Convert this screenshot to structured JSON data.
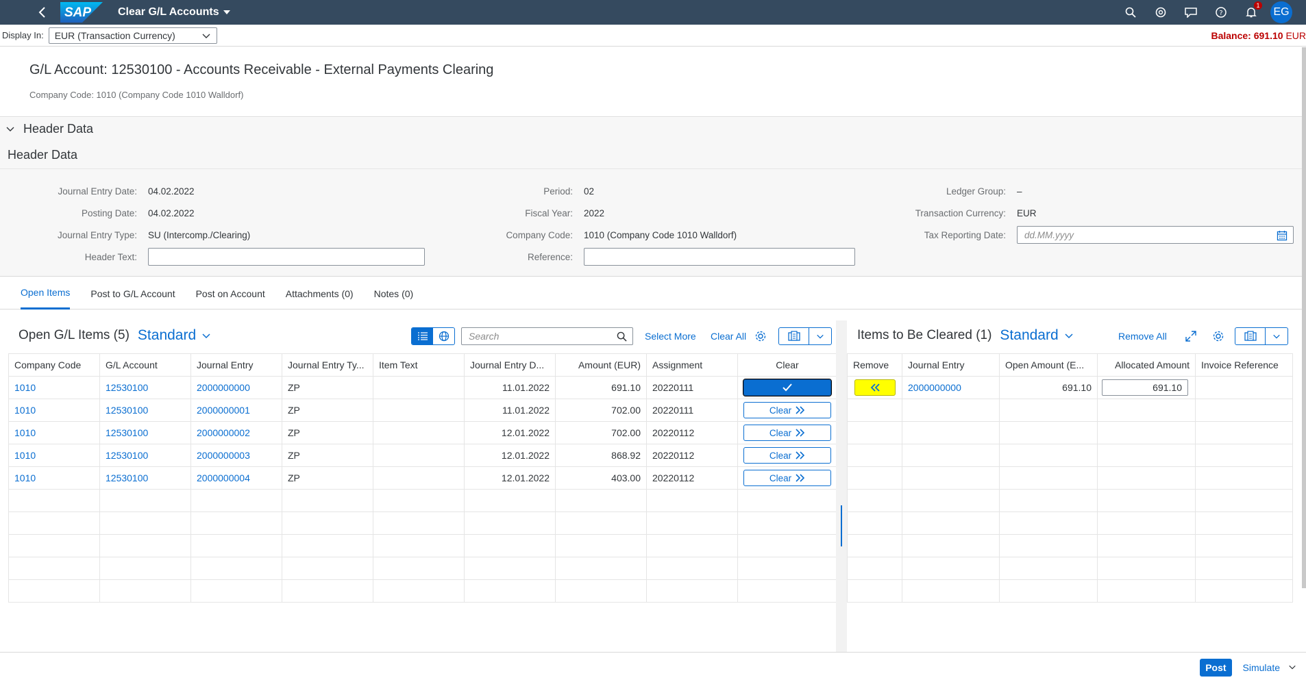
{
  "shell": {
    "title": "Clear G/L Accounts",
    "logo": "SAP",
    "notification_count": "1",
    "user_initials": "EG",
    "icons": [
      "back-icon",
      "search-icon",
      "copilot-icon",
      "feedback-icon",
      "help-icon",
      "bell-icon"
    ]
  },
  "display": {
    "label": "Display In:",
    "value": "EUR (Transaction Currency)",
    "balance_label": "Balance:",
    "balance_value": "691.10",
    "balance_currency": "EUR"
  },
  "header": {
    "title": "G/L Account: 12530100 - Accounts Receivable - External Payments Clearing",
    "subtitle": "Company Code: 1010 (Company Code 1010 Walldorf)"
  },
  "header_data": {
    "toggle_label": "Header Data",
    "section_title": "Header Data",
    "fields": {
      "journal_entry_date": {
        "label": "Journal Entry Date:",
        "value": "04.02.2022"
      },
      "posting_date": {
        "label": "Posting Date:",
        "value": "04.02.2022"
      },
      "journal_entry_type": {
        "label": "Journal Entry Type:",
        "value": "SU (Intercomp./Clearing)"
      },
      "header_text": {
        "label": "Header Text:",
        "value": ""
      },
      "period": {
        "label": "Period:",
        "value": "02"
      },
      "fiscal_year": {
        "label": "Fiscal Year:",
        "value": "2022"
      },
      "company_code": {
        "label": "Company Code:",
        "value": "1010 (Company Code 1010 Walldorf)"
      },
      "reference": {
        "label": "Reference:",
        "value": ""
      },
      "ledger_group": {
        "label": "Ledger Group:",
        "value": "–"
      },
      "transaction_currency": {
        "label": "Transaction Currency:",
        "value": "EUR"
      },
      "tax_reporting_date": {
        "label": "Tax Reporting Date:",
        "placeholder": "dd.MM.yyyy"
      }
    }
  },
  "tabs": [
    {
      "label": "Open Items",
      "active": true
    },
    {
      "label": "Post to G/L Account"
    },
    {
      "label": "Post on Account"
    },
    {
      "label": "Attachments (0)"
    },
    {
      "label": "Notes (0)"
    }
  ],
  "open_items": {
    "title": "Open G/L Items (5)",
    "variant": "Standard",
    "search_placeholder": "Search",
    "select_more": "Select More",
    "clear_all": "Clear All",
    "columns": [
      "Company Code",
      "G/L Account",
      "Journal Entry",
      "Journal Entry Ty...",
      "Item Text",
      "Journal Entry D...",
      "Amount (EUR)",
      "Assignment",
      "Clear"
    ],
    "clear_label": "Clear",
    "rows": [
      {
        "company_code": "1010",
        "gl_account": "12530100",
        "journal_entry": "2000000000",
        "type": "ZP",
        "item_text": "",
        "date": "11.01.2022",
        "amount": "691.10",
        "assignment": "20220111",
        "selected": true
      },
      {
        "company_code": "1010",
        "gl_account": "12530100",
        "journal_entry": "2000000001",
        "type": "ZP",
        "item_text": "",
        "date": "11.01.2022",
        "amount": "702.00",
        "assignment": "20220111",
        "selected": false
      },
      {
        "company_code": "1010",
        "gl_account": "12530100",
        "journal_entry": "2000000002",
        "type": "ZP",
        "item_text": "",
        "date": "12.01.2022",
        "amount": "702.00",
        "assignment": "20220112",
        "selected": false
      },
      {
        "company_code": "1010",
        "gl_account": "12530100",
        "journal_entry": "2000000003",
        "type": "ZP",
        "item_text": "",
        "date": "12.01.2022",
        "amount": "868.92",
        "assignment": "20220112",
        "selected": false
      },
      {
        "company_code": "1010",
        "gl_account": "12530100",
        "journal_entry": "2000000004",
        "type": "ZP",
        "item_text": "",
        "date": "12.01.2022",
        "amount": "403.00",
        "assignment": "20220112",
        "selected": false
      }
    ]
  },
  "to_clear": {
    "title": "Items to Be Cleared (1)",
    "variant": "Standard",
    "remove_all": "Remove All",
    "columns": [
      "Remove",
      "Journal Entry",
      "Open Amount (E...",
      "Allocated Amount",
      "Invoice Reference"
    ],
    "rows": [
      {
        "journal_entry": "2000000000",
        "open_amount": "691.10",
        "allocated_amount": "691.10",
        "invoice_reference": ""
      }
    ]
  },
  "footer": {
    "post": "Post",
    "simulate": "Simulate"
  },
  "colors": {
    "shell": "#354a5f",
    "accent": "#0a6ed1",
    "balance": "#bb0000",
    "highlight": "#ffff00"
  }
}
